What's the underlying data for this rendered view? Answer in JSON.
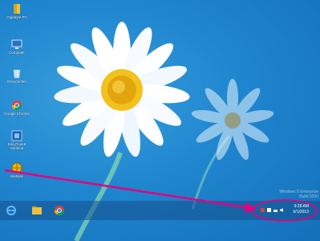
{
  "desktop_icons": [
    {
      "label": "Gigabyte PC",
      "icon": "user-folder-icon"
    },
    {
      "label": "Computer",
      "icon": "computer-icon"
    },
    {
      "label": "Recycle Bin",
      "icon": "recycle-bin-icon"
    },
    {
      "label": "Google Chrome",
      "icon": "chrome-icon"
    },
    {
      "label": "EasyTune6 Shortcut",
      "icon": "easytune-icon"
    },
    {
      "label": "Website",
      "icon": "globe-icon"
    }
  ],
  "taskbar": {
    "buttons": [
      {
        "name": "internet-explorer",
        "icon": "ie-icon"
      },
      {
        "name": "file-explorer",
        "icon": "folder-icon"
      },
      {
        "name": "chrome",
        "icon": "chrome-icon"
      }
    ],
    "clock_time": "9:28 AM",
    "clock_date": "6/1/2013"
  },
  "watermark": {
    "line1": "Windows 8 Enterprise",
    "line2": "Build 9200"
  },
  "annotation_color": "#e6007e"
}
